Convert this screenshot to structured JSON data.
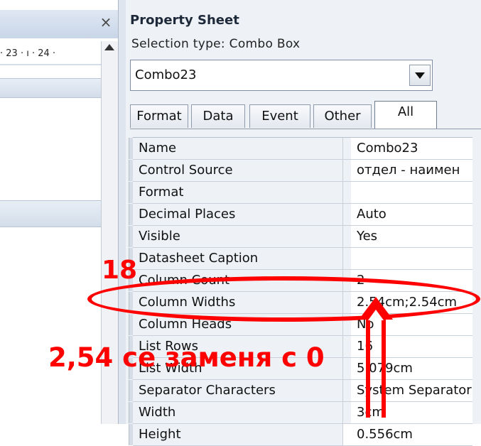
{
  "left_pane": {
    "close_glyph": "×",
    "ruler_text": "· 23 · ı · 24 ·"
  },
  "property_sheet": {
    "title": "Property Sheet",
    "selection_type": "Selection type:  Combo Box",
    "object_combo": {
      "value": "Combo23"
    },
    "tabs": [
      {
        "label": "Format",
        "active": false
      },
      {
        "label": "Data",
        "active": false
      },
      {
        "label": "Event",
        "active": false
      },
      {
        "label": "Other",
        "active": false
      },
      {
        "label": "All",
        "active": true
      }
    ],
    "properties": [
      {
        "name": "Name",
        "value": "Combo23"
      },
      {
        "name": "Control Source",
        "value": "отдел - наимен"
      },
      {
        "name": "Format",
        "value": ""
      },
      {
        "name": "Decimal Places",
        "value": "Auto"
      },
      {
        "name": "Visible",
        "value": "Yes"
      },
      {
        "name": "Datasheet Caption",
        "value": ""
      },
      {
        "name": "Column Count",
        "value": "2"
      },
      {
        "name": "Column Widths",
        "value": "2.54cm;2.54cm"
      },
      {
        "name": "Column Heads",
        "value": "No"
      },
      {
        "name": "List Rows",
        "value": "16"
      },
      {
        "name": "List Width",
        "value": "5.079cm"
      },
      {
        "name": "Separator Characters",
        "value": "System Separator"
      },
      {
        "name": "Width",
        "value": "3cm"
      },
      {
        "name": "Height",
        "value": "0.556cm"
      }
    ]
  },
  "annotations": {
    "number": "18",
    "note": "2,54 се заменя с 0",
    "color": "#ff0000"
  }
}
